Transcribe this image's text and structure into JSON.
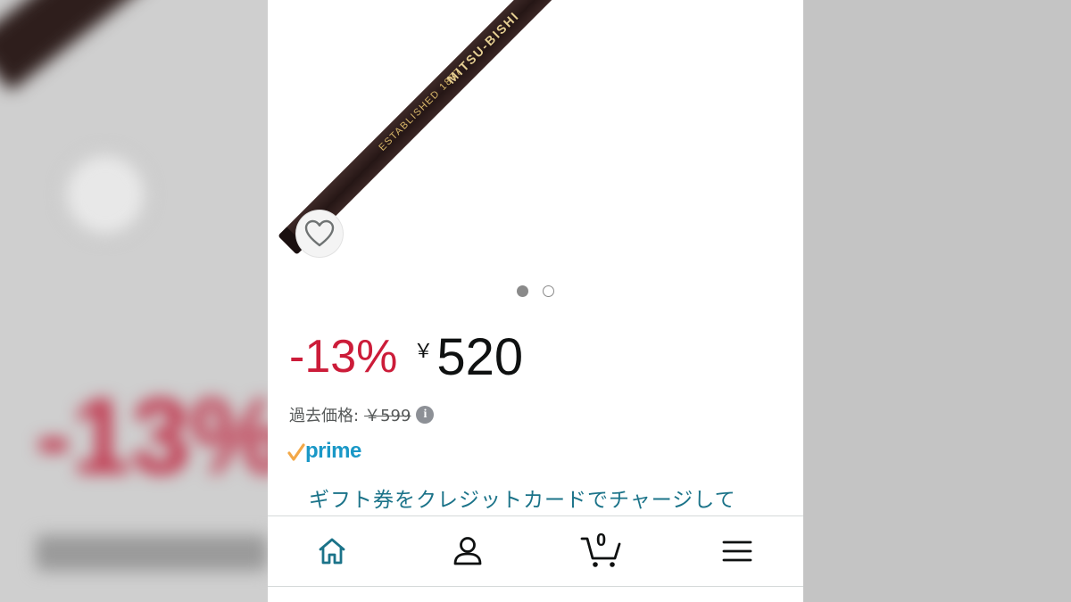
{
  "product": {
    "image_brand_text": "MITSU-BISHI",
    "image_established_text": "ESTABLISHED 1887",
    "carousel": {
      "total_dots": 2,
      "active_index": 0
    }
  },
  "pricing": {
    "discount": "-13%",
    "currency_symbol": "￥",
    "price": "520",
    "past_price_label": "過去価格:",
    "past_price_value": "￥599"
  },
  "prime": {
    "label": "prime",
    "check_color": "#f3a847",
    "text_color": "#1a98c7"
  },
  "promo": {
    "link_text": "ギフト券をクレジットカードでチャージして"
  },
  "nav": {
    "items": [
      {
        "name": "home",
        "icon": "home-icon",
        "active": true
      },
      {
        "name": "account",
        "icon": "user-icon"
      },
      {
        "name": "cart",
        "icon": "cart-icon",
        "count": "0"
      },
      {
        "name": "menu",
        "icon": "hamburger-icon"
      }
    ]
  },
  "colors": {
    "discount": "#cc1c39",
    "link": "#1b7389",
    "price": "#0f1111"
  }
}
